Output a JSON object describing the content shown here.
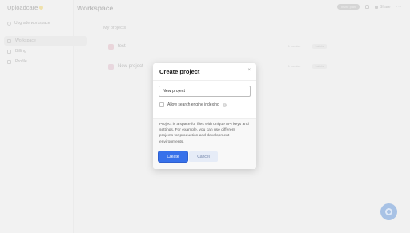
{
  "app": {
    "brand": "Uploadcare"
  },
  "sidebar": {
    "upgrade_label": "Upgrade workspace",
    "items": [
      {
        "label": "Workspace",
        "icon": "workspace-icon",
        "active": true
      },
      {
        "label": "Billing",
        "icon": "billing-icon",
        "active": false
      },
      {
        "label": "Profile",
        "icon": "profile-icon",
        "active": false
      }
    ]
  },
  "header": {
    "title": "Workspace",
    "badge": "Invite plan",
    "share_label": "Share",
    "more_glyph": "···"
  },
  "main": {
    "section_label": "My projects",
    "projects": [
      {
        "name": "test",
        "meta": "1 member",
        "action": "Labels",
        "color": "#e8c9d2"
      },
      {
        "name": "New project",
        "meta": "1 member",
        "action": "Labels",
        "color": "#e6cdd7"
      }
    ]
  },
  "modal": {
    "title": "Create project",
    "close_glyph": "×",
    "name_value": "New project",
    "checkbox_label": "Allow search engine indexing",
    "info_glyph": "i",
    "description": "Project is a space for files with unique API keys and settings. For example, you can use different projects for production and development environments.",
    "create_label": "Create",
    "cancel_label": "Cancel"
  },
  "colors": {
    "primary": "#3771ea",
    "fab": "#a8c2e5"
  }
}
